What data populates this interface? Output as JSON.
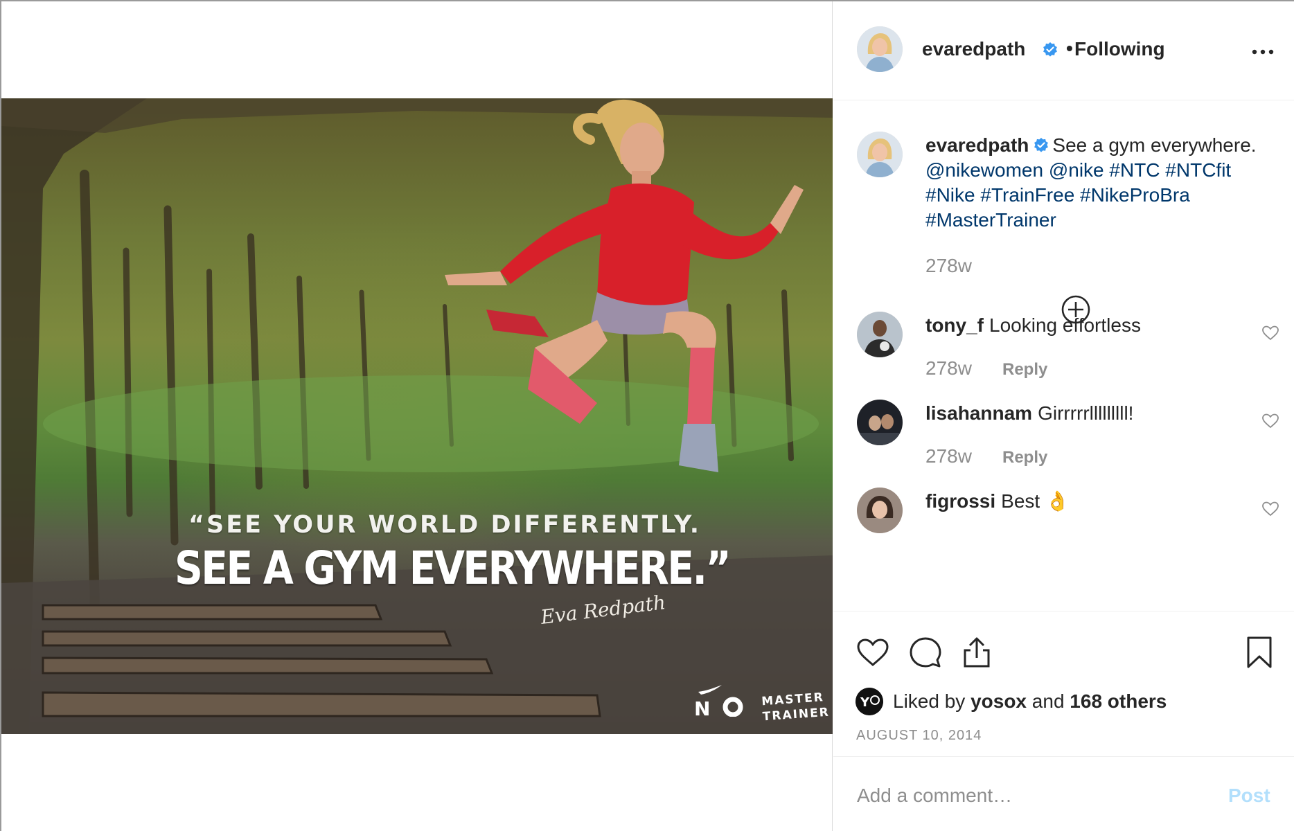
{
  "post": {
    "username": "evaredpath",
    "follow_status": "Following",
    "separator": "•",
    "photo": {
      "quote_line1": "“SEE YOUR WORLD DIFFERENTLY.",
      "quote_line2": "SEE A GYM EVERYWHERE.”",
      "signature": "Eva Redpath",
      "badge_line1": "MASTER",
      "badge_line2": "TRAINER"
    },
    "caption": {
      "username": "evaredpath",
      "text": "See a gym everywhere.",
      "hashtags": "@nikewomen @nike #NTC #NTCfit #Nike #TrainFree #NikeProBra #MasterTrainer",
      "time": "278w"
    },
    "comments": [
      {
        "username": "tony_f",
        "text": "Looking effortless",
        "time": "278w",
        "reply": "Reply"
      },
      {
        "username": "lisahannam",
        "text": "Girrrrrlllllllll!",
        "time": "278w",
        "reply": "Reply"
      },
      {
        "username": "figrossi",
        "text": "Best 👌",
        "time": "",
        "reply": ""
      }
    ],
    "likes": {
      "prefix": "Liked by",
      "user": "yosox",
      "and": "and",
      "others": "168 others"
    },
    "date": "AUGUST 10, 2014",
    "add_comment_placeholder": "Add a comment…",
    "post_button": "Post"
  },
  "colors": {
    "verified": "#3897f0",
    "link": "#00376b",
    "muted": "#8e8e8e",
    "post_button_disabled": "#b2dffc",
    "shirt": "#d8202a"
  },
  "icons": [
    "verified-badge-icon",
    "more-options-icon",
    "load-more-comments-icon",
    "heart-icon",
    "comment-icon",
    "share-icon",
    "bookmark-icon"
  ]
}
